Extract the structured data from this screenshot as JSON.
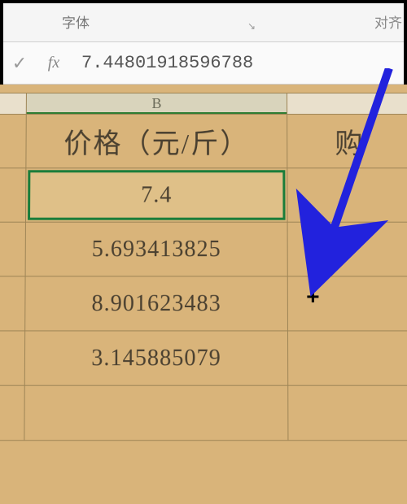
{
  "ribbon": {
    "group_font": "字体",
    "group_align": "对齐",
    "launcher_glyph": "↘"
  },
  "formula_bar": {
    "accept_glyph": "✓",
    "fx_label": "fx",
    "value": "7.44801918596788"
  },
  "sheet": {
    "column_letter": "B",
    "header_b": "价格（元/斤）",
    "header_c": "购",
    "selected_cell_display": "7.4",
    "rows": [
      "5.693413825",
      "8.901623483",
      "3.145885079"
    ]
  },
  "chart_data": {
    "type": "table",
    "title": "价格（元/斤）",
    "columns": [
      "B"
    ],
    "values": [
      7.44801918596788,
      5.693413825,
      8.901623483,
      3.145885079
    ],
    "formatted_selected": "7.4"
  },
  "cursor": {
    "fill_handle_glyph": "+"
  },
  "colors": {
    "accent_green": "#1a7d3a",
    "arrow_blue": "#2222dd"
  }
}
